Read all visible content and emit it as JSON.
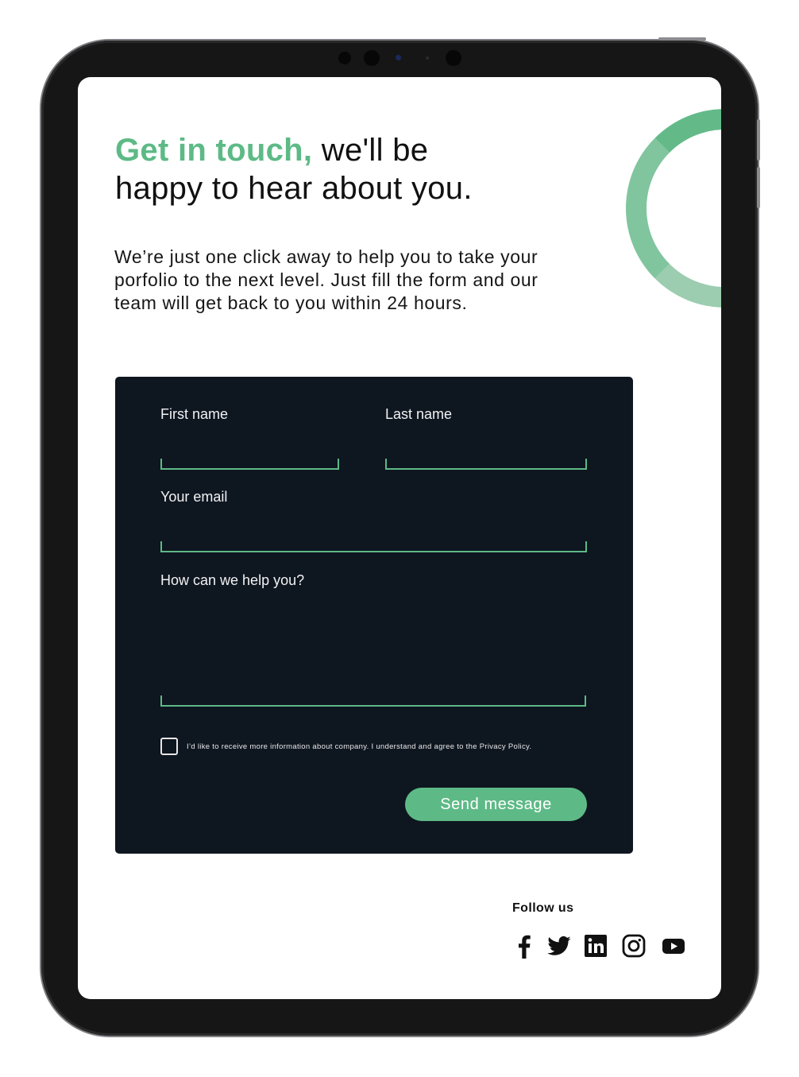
{
  "hero": {
    "title_accent": "Get in touch,",
    "title_line1_rest": " we'll be",
    "title_line2": "happy to hear about you.",
    "intro_line1": "We’re just one click away to help you to take your",
    "intro_line2": "porfolio to the next level. Just fill the form and our",
    "intro_line3": "team will get back to you within 24 hours."
  },
  "form": {
    "first_name_label": "First name",
    "last_name_label": "Last name",
    "email_label": "Your email",
    "message_label": "How can we help you?",
    "first_name_value": "",
    "last_name_value": "",
    "email_value": "",
    "message_value": "",
    "consent_text": "I’d like to receive more information about company. I understand and agree to the Privacy Policy.",
    "consent_checked": false,
    "submit_label": "Send message"
  },
  "footer": {
    "follow_label": "Follow us",
    "social_icons": [
      "facebook-icon",
      "twitter-icon",
      "linkedin-icon",
      "instagram-icon",
      "youtube-icon"
    ]
  },
  "colors": {
    "accent": "#5dba86",
    "form_background": "#0e1620",
    "device_frame": "#161616"
  }
}
